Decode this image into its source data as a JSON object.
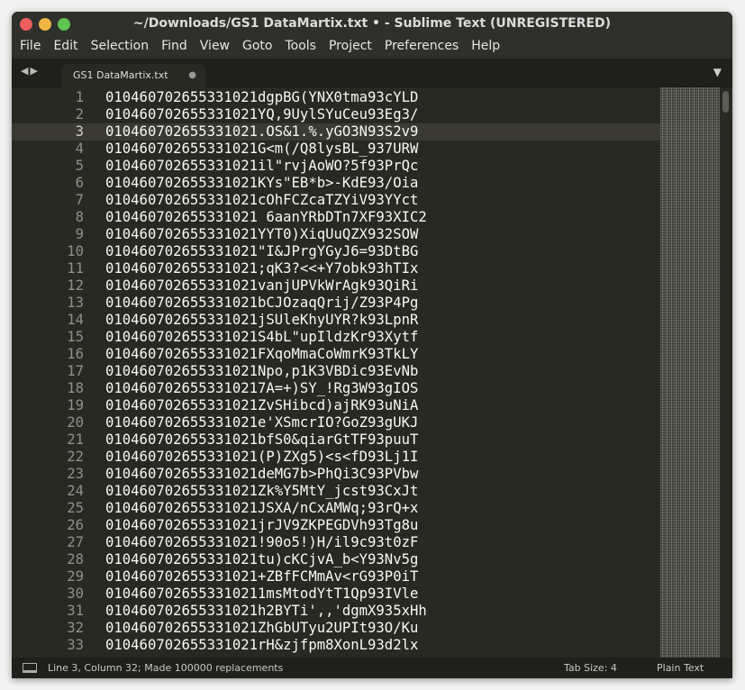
{
  "window": {
    "title": "~/Downloads/GS1 DataMartix.txt • - Sublime Text (UNREGISTERED)"
  },
  "menu": [
    "File",
    "Edit",
    "Selection",
    "Find",
    "View",
    "Goto",
    "Tools",
    "Project",
    "Preferences",
    "Help"
  ],
  "tab": {
    "label": "GS1 DataMartix.txt",
    "modified": "●"
  },
  "editor": {
    "current_line": 3,
    "lines": [
      "010460702655331021dgpBG(YNX0tma93cYLD",
      "010460702655331021YQ,9UylSYuCeu93Eg3/",
      "010460702655331021.OS&1.%.yGO3N93S2v9",
      "010460702655331021G<m(/Q8lysBL_937URW",
      "010460702655331021il\"rvjAoWO?5f93PrQc",
      "010460702655331021KYs\"EB*b>-KdE93/Oia",
      "010460702655331021cOhFCZcaTZYiV93YYct",
      "010460702655331021 6aanYRbDTn7XF93XIC2",
      "010460702655331021YYT0)XiqUuQZX932SOW",
      "010460702655331021\"I&JPrgYGyJ6=93DtBG",
      "010460702655331021;qK3?<<+Y7obk93hTIx",
      "010460702655331021vanjUPVkWrAgk93QiRi",
      "010460702655331021bCJOzaqQrij/Z93P4Pg",
      "010460702655331021jSUleKhyUYR?k93LpnR",
      "010460702655331021S4bL\"upIldzKr93Xytf",
      "010460702655331021FXqoMmaCoWmrK93TkLY",
      "010460702655331021Npo,p1K3VBDic93EvNb",
      "0104607026553310217A=+)SY_!Rg3W93gIOS",
      "010460702655331021ZvSHibcd)ajRK93uNiA",
      "010460702655331021e'XSmcrIO?GoZ93gUKJ",
      "010460702655331021bfS0&qiarGtTF93puuT",
      "010460702655331021(P)ZXg5)<s<fD93Lj1I",
      "010460702655331021deMG7b>PhQi3C93PVbw",
      "010460702655331021Zk%Y5MtY_jcst93CxJt",
      "010460702655331021JSXA/nCxAMWq;93rQ+x",
      "010460702655331021jrJV9ZKPEGDVh93Tg8u",
      "010460702655331021!90o5!)H/il9c93t0zF",
      "010460702655331021tu)cKCjvA_b<Y93Nv5g",
      "010460702655331021+ZBfFCMmAv<rG93P0iT",
      "0104607026553310211msMtodYtT1Qp93IVle",
      "010460702655331021h2BYTi',,'dgmX935xHh",
      "010460702655331021ZhGbUTyu2UPIt93O/Ku",
      "010460702655331021rH&zjfpm8XonL93d2lx"
    ]
  },
  "status": {
    "position": "Line 3, Column 32; Made 100000 replacements",
    "tab_size": "Tab Size: 4",
    "syntax": "Plain Text"
  }
}
